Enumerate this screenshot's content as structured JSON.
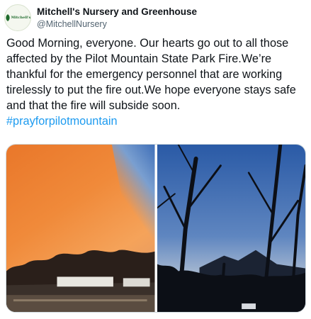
{
  "tweet": {
    "display_name": "Mitchell's Nursery and Greenhouse",
    "handle": "@MitchellNursery",
    "avatar_text": "Mitchell's",
    "text": "Good Morning, everyone. Our hearts go out to all those affected by the Pilot Mountain State Park Fire.We’re thankful for the emergency personnel that are working tirelessly to put the fire out.We hope everyone stays safe and that the fire will subside soon.",
    "hashtag": "#prayforpilotmountain"
  },
  "colors": {
    "link": "#1d9bf0",
    "text": "#0f1419",
    "secondary": "#536471",
    "brand_green": "#1f6b2c"
  },
  "media": {
    "photos": [
      {
        "name": "orange-smoke-sky-over-greenhouses"
      },
      {
        "name": "silhouetted-trees-at-dusk-with-mountain"
      }
    ]
  }
}
